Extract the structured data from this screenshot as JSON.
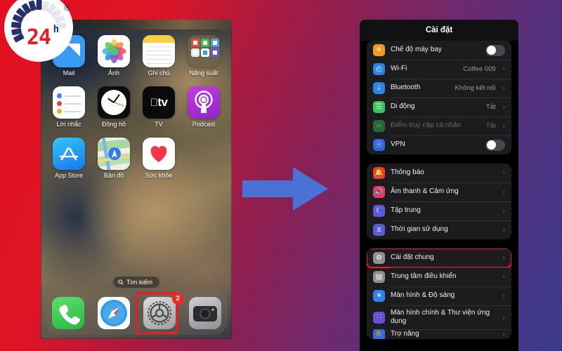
{
  "logo": {
    "number": "24",
    "sup": "h",
    "reg": "®",
    "name": "24h-logo"
  },
  "phone": {
    "apps": [
      {
        "label": "Mail",
        "icon": "mail-icon"
      },
      {
        "label": "Ảnh",
        "icon": "photos-icon"
      },
      {
        "label": "Ghi chú",
        "icon": "notes-icon"
      },
      {
        "label": "Năng suất",
        "icon": "folder-icon"
      },
      {
        "label": "Lời nhắc",
        "icon": "reminders-icon"
      },
      {
        "label": "Đồng hồ",
        "icon": "clock-icon"
      },
      {
        "label": "TV",
        "icon": "tv-icon"
      },
      {
        "label": "Podcast",
        "icon": "podcast-icon"
      },
      {
        "label": "App Store",
        "icon": "appstore-icon"
      },
      {
        "label": "Bản đồ",
        "icon": "maps-icon"
      },
      {
        "label": "Sức khỏe",
        "icon": "health-icon"
      }
    ],
    "tv_text": "tv",
    "search": {
      "label": "Tìm kiếm",
      "icon": "search-icon"
    },
    "dock": [
      {
        "label": "Phone",
        "icon": "phone-icon"
      },
      {
        "label": "Safari",
        "icon": "safari-icon"
      },
      {
        "label": "Cài đặt",
        "icon": "settings-gear-icon",
        "badge": "2",
        "highlighted": true
      },
      {
        "label": "Camera",
        "icon": "camera-icon"
      }
    ]
  },
  "arrow": {
    "name": "right-arrow",
    "color": "#4a72d4"
  },
  "settings": {
    "title": "Cài đặt",
    "groups": [
      {
        "rows": [
          {
            "label": "Chế độ máy bay",
            "icon": "airplane-icon",
            "icon_color": "#f59a20",
            "glyph": "✈",
            "control": "toggle",
            "toggle_on": false
          },
          {
            "label": "Wi-Fi",
            "icon": "wifi-icon",
            "icon_color": "#2f83e8",
            "glyph": "◴",
            "value": "Coffee 009",
            "control": "chevron"
          },
          {
            "label": "Bluetooth",
            "icon": "bluetooth-icon",
            "icon_color": "#2f83e8",
            "glyph": "ᛦ",
            "value": "Không kết nối",
            "control": "chevron"
          },
          {
            "label": "Di động",
            "icon": "cellular-icon",
            "icon_color": "#35c759",
            "glyph": "☰",
            "value": "Tắt",
            "control": "chevron"
          },
          {
            "label": "Điểm truy cập cá nhân",
            "icon": "hotspot-icon",
            "icon_color": "#35c759",
            "glyph": "∞",
            "value": "Tắt",
            "control": "chevron",
            "dim": true
          },
          {
            "label": "VPN",
            "icon": "vpn-icon",
            "icon_color": "#2f63e0",
            "glyph": "ⓥ",
            "control": "toggle",
            "toggle_on": false
          }
        ]
      },
      {
        "rows": [
          {
            "label": "Thông báo",
            "icon": "bell-icon",
            "icon_color": "#ef3b30",
            "glyph": "🔔",
            "control": "chevron"
          },
          {
            "label": "Âm thanh & Cảm ứng",
            "icon": "speaker-icon",
            "icon_color": "#e8366a",
            "glyph": "🔊",
            "control": "chevron"
          },
          {
            "label": "Tập trung",
            "icon": "moon-icon",
            "icon_color": "#5b5bd6",
            "glyph": "☾",
            "control": "chevron"
          },
          {
            "label": "Thời gian sử dụng",
            "icon": "hourglass-icon",
            "icon_color": "#5b5bd6",
            "glyph": "⧖",
            "control": "chevron"
          }
        ]
      },
      {
        "rows": [
          {
            "label": "Cài đặt chung",
            "icon": "gear-icon",
            "icon_color": "#8e8e93",
            "glyph": "⚙",
            "control": "chevron",
            "highlighted": true
          },
          {
            "label": "Trung tâm điều khiển",
            "icon": "control-center-icon",
            "icon_color": "#8e8e93",
            "glyph": "▤",
            "control": "chevron"
          },
          {
            "label": "Màn hình & Độ sáng",
            "icon": "brightness-icon",
            "icon_color": "#2f83e8",
            "glyph": "☀",
            "control": "chevron"
          },
          {
            "label": "Màn hình chính & Thư viện ứng dụng",
            "icon": "home-screen-icon",
            "icon_color": "#6a4fd6",
            "glyph": "∷",
            "control": "chevron",
            "tall": true
          },
          {
            "label": "Trợ năng",
            "icon": "accessibility-icon",
            "icon_color": "#2f6fe0",
            "glyph": "⛹",
            "control": "chevron",
            "cut": true
          }
        ]
      }
    ]
  }
}
